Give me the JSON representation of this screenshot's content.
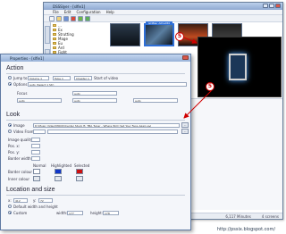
{
  "main_window": {
    "title": "DSSSlyer - [slfie1]",
    "menu": [
      "File",
      "Edit",
      "Configuration",
      "Help"
    ],
    "tree_items": [
      "…",
      "Ex",
      "Strutting",
      "Mage",
      "Eu",
      "Ard",
      "Fight",
      "…"
    ],
    "thumb_selected_label": "GDBler Alfred80",
    "status_items": [
      "6,117 Minutes",
      "4 screens"
    ]
  },
  "dialog": {
    "title": "Properties - [slfie1]",
    "action": {
      "title": "Action",
      "jump_to_label": "Jump to",
      "jump_sel1": "Volume 1",
      "jump_sel2": "Tube 1",
      "jump_sel3": "Chapter 1",
      "jump_end": "Start of video",
      "options_label": "Options",
      "options_value": "auto (Select 1 Str)",
      "focus_label": "Focus",
      "focus_value": "auto",
      "sub_value": "auto",
      "audio_value": "auto",
      "subtitle_value": "auto"
    },
    "look": {
      "title": "Look",
      "image_label": "Image",
      "image_path": "D:\\Music Video\\MOOD\\Center Stuck ft. TBA Tuner - Where Will I Set Your Face Again.avi",
      "video_frame_label": "Video Frame",
      "image_quality_label": "Image quality",
      "pos_x_label": "Pos. x:",
      "pos_y_label": "Pos. y:",
      "border_width_label": "Border width",
      "col_normal": "Normal",
      "col_highlighted": "Highlighted",
      "col_selected": "Selected",
      "border_colour_label": "Border colour",
      "inner_colour_label": "Inner colour",
      "btn_label": "..."
    },
    "location": {
      "title": "Location and size",
      "x_label": "x:",
      "x_value": "412",
      "y_label": "y:",
      "y_value": "72",
      "default_wh_label": "Default width and height",
      "custom_label": "Custom",
      "width_label": "width:",
      "width_value": "177",
      "height_label": "height:",
      "height_value": "178"
    }
  },
  "annotations": {
    "badge_top": "5",
    "badge_mid": "5"
  },
  "footer": "http://pssix.blogspot.com/",
  "colors": {
    "annotation_red": "#d00000",
    "highlight_blue": "#1036c8",
    "selected_red": "#cc1010"
  }
}
